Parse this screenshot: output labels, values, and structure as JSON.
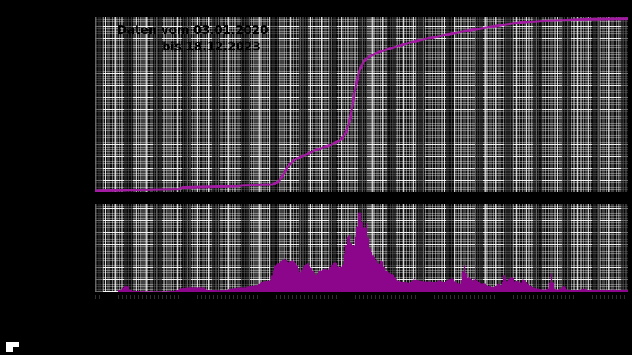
{
  "app": {
    "background_color": "#000000",
    "description": "Two stacked plot panels on black background with dense gray grid mesh; cumulative purple line on top, daily purple histogram bars below; axis tick labels not visible against background"
  },
  "title": {
    "line1": "Daten vom 03.01.2020",
    "line2": "bis 18.12.2023"
  },
  "colors": {
    "line": "#A21BA2",
    "bars": "#8B068B",
    "title_text": "#000000",
    "ticks": "#2E2E2E",
    "corner_glyph": "#FFFFFF"
  },
  "chart_data": [
    {
      "type": "line",
      "title": "Daten vom 03.01.2020 bis 18.12.2023",
      "x_range": [
        "03.01.2020",
        "18.12.2023"
      ],
      "xlabel": "",
      "ylabel": "",
      "legend": "none",
      "grid": "dense minor+major grid mesh",
      "units": "normalized 0-1 (x = fraction of date range, y = fraction of panel height; numeric axis labels not visible in screenshot)",
      "color": "#A21BA2",
      "points": [
        [
          0.0,
          0.009
        ],
        [
          0.059,
          0.014
        ],
        [
          0.126,
          0.018
        ],
        [
          0.159,
          0.02
        ],
        [
          0.164,
          0.029
        ],
        [
          0.207,
          0.032
        ],
        [
          0.267,
          0.036
        ],
        [
          0.276,
          0.041
        ],
        [
          0.332,
          0.045
        ],
        [
          0.344,
          0.059
        ],
        [
          0.353,
          0.099
        ],
        [
          0.363,
          0.153
        ],
        [
          0.373,
          0.185
        ],
        [
          0.393,
          0.212
        ],
        [
          0.415,
          0.243
        ],
        [
          0.441,
          0.27
        ],
        [
          0.462,
          0.302
        ],
        [
          0.471,
          0.342
        ],
        [
          0.479,
          0.423
        ],
        [
          0.487,
          0.568
        ],
        [
          0.496,
          0.694
        ],
        [
          0.505,
          0.752
        ],
        [
          0.516,
          0.779
        ],
        [
          0.533,
          0.802
        ],
        [
          0.556,
          0.824
        ],
        [
          0.585,
          0.851
        ],
        [
          0.622,
          0.878
        ],
        [
          0.659,
          0.901
        ],
        [
          0.696,
          0.923
        ],
        [
          0.733,
          0.941
        ],
        [
          0.77,
          0.959
        ],
        [
          0.807,
          0.973
        ],
        [
          0.844,
          0.98
        ],
        [
          0.881,
          0.984
        ],
        [
          0.919,
          0.989
        ],
        [
          0.963,
          0.991
        ],
        [
          1.0,
          0.993
        ]
      ]
    },
    {
      "type": "bar",
      "title": "",
      "x_range": [
        "03.01.2020",
        "18.12.2023"
      ],
      "xlabel": "",
      "ylabel": "",
      "legend": "none",
      "grid": "dense minor+major grid mesh",
      "units": "normalized 0-1 (x = fraction of date range, h = bar height fraction of panel; numeric axis labels not visible in screenshot)",
      "color": "#8B068B",
      "points": [
        [
          0.0,
          0.0
        ],
        [
          0.041,
          0.0
        ],
        [
          0.044,
          0.02
        ],
        [
          0.05,
          0.03
        ],
        [
          0.056,
          0.06
        ],
        [
          0.061,
          0.07
        ],
        [
          0.065,
          0.03
        ],
        [
          0.071,
          0.01
        ],
        [
          0.119,
          0.005
        ],
        [
          0.151,
          0.01
        ],
        [
          0.16,
          0.04
        ],
        [
          0.175,
          0.05
        ],
        [
          0.19,
          0.05
        ],
        [
          0.204,
          0.05
        ],
        [
          0.213,
          0.02
        ],
        [
          0.237,
          0.015
        ],
        [
          0.258,
          0.04
        ],
        [
          0.273,
          0.05
        ],
        [
          0.284,
          0.05
        ],
        [
          0.293,
          0.07
        ],
        [
          0.305,
          0.08
        ],
        [
          0.317,
          0.12
        ],
        [
          0.329,
          0.13
        ],
        [
          0.338,
          0.3
        ],
        [
          0.347,
          0.33
        ],
        [
          0.356,
          0.38
        ],
        [
          0.363,
          0.33
        ],
        [
          0.37,
          0.36
        ],
        [
          0.378,
          0.32
        ],
        [
          0.385,
          0.22
        ],
        [
          0.393,
          0.3
        ],
        [
          0.4,
          0.32
        ],
        [
          0.407,
          0.26
        ],
        [
          0.415,
          0.19
        ],
        [
          0.422,
          0.24
        ],
        [
          0.43,
          0.26
        ],
        [
          0.439,
          0.25
        ],
        [
          0.446,
          0.32
        ],
        [
          0.452,
          0.34
        ],
        [
          0.458,
          0.27
        ],
        [
          0.465,
          0.3
        ],
        [
          0.47,
          0.5
        ],
        [
          0.476,
          0.67
        ],
        [
          0.48,
          0.55
        ],
        [
          0.486,
          0.52
        ],
        [
          0.492,
          0.74
        ],
        [
          0.496,
          0.96
        ],
        [
          0.501,
          0.78
        ],
        [
          0.505,
          0.7
        ],
        [
          0.51,
          0.78
        ],
        [
          0.514,
          0.52
        ],
        [
          0.52,
          0.43
        ],
        [
          0.526,
          0.38
        ],
        [
          0.532,
          0.3
        ],
        [
          0.538,
          0.37
        ],
        [
          0.544,
          0.25
        ],
        [
          0.551,
          0.22
        ],
        [
          0.559,
          0.2
        ],
        [
          0.567,
          0.13
        ],
        [
          0.578,
          0.11
        ],
        [
          0.59,
          0.1
        ],
        [
          0.599,
          0.14
        ],
        [
          0.607,
          0.13
        ],
        [
          0.618,
          0.12
        ],
        [
          0.628,
          0.12
        ],
        [
          0.638,
          0.11
        ],
        [
          0.646,
          0.13
        ],
        [
          0.655,
          0.11
        ],
        [
          0.664,
          0.14
        ],
        [
          0.671,
          0.15
        ],
        [
          0.679,
          0.1
        ],
        [
          0.686,
          0.09
        ],
        [
          0.693,
          0.31
        ],
        [
          0.698,
          0.16
        ],
        [
          0.702,
          0.17
        ],
        [
          0.708,
          0.12
        ],
        [
          0.713,
          0.15
        ],
        [
          0.719,
          0.12
        ],
        [
          0.724,
          0.09
        ],
        [
          0.73,
          0.1
        ],
        [
          0.738,
          0.07
        ],
        [
          0.745,
          0.05
        ],
        [
          0.751,
          0.06
        ],
        [
          0.757,
          0.1
        ],
        [
          0.763,
          0.07
        ],
        [
          0.767,
          0.19
        ],
        [
          0.773,
          0.12
        ],
        [
          0.778,
          0.16
        ],
        [
          0.784,
          0.17
        ],
        [
          0.788,
          0.12
        ],
        [
          0.793,
          0.13
        ],
        [
          0.799,
          0.09
        ],
        [
          0.804,
          0.15
        ],
        [
          0.81,
          0.1
        ],
        [
          0.816,
          0.07
        ],
        [
          0.822,
          0.05
        ],
        [
          0.83,
          0.04
        ],
        [
          0.837,
          0.03
        ],
        [
          0.844,
          0.03
        ],
        [
          0.852,
          0.04
        ],
        [
          0.856,
          0.22
        ],
        [
          0.861,
          0.04
        ],
        [
          0.867,
          0.03
        ],
        [
          0.874,
          0.04
        ],
        [
          0.88,
          0.07
        ],
        [
          0.886,
          0.03
        ],
        [
          0.893,
          0.02
        ],
        [
          0.901,
          0.02
        ],
        [
          0.91,
          0.03
        ],
        [
          0.919,
          0.04
        ],
        [
          0.927,
          0.02
        ],
        [
          0.936,
          0.02
        ],
        [
          0.945,
          0.03
        ],
        [
          0.954,
          0.02
        ],
        [
          0.963,
          0.02
        ],
        [
          0.972,
          0.03
        ],
        [
          0.981,
          0.02
        ],
        [
          0.99,
          0.03
        ],
        [
          1.0,
          0.02
        ]
      ]
    }
  ]
}
